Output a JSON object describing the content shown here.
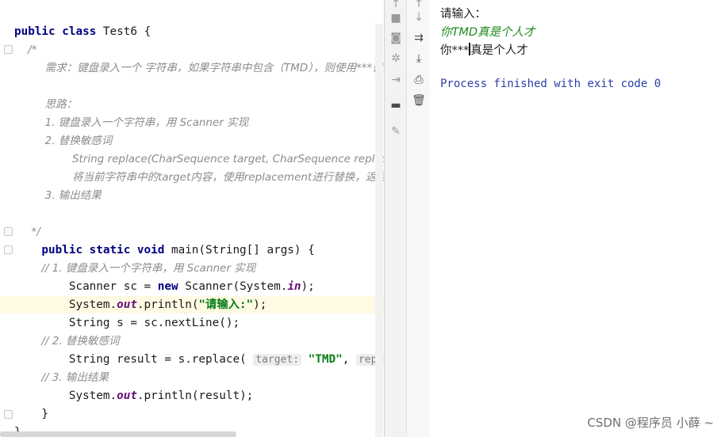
{
  "editor": {
    "lines": [
      {
        "parts": [
          {
            "t": "public ",
            "c": "kw"
          },
          {
            "t": "class ",
            "c": "kw"
          },
          {
            "t": "Test6 {",
            "c": ""
          }
        ]
      },
      {
        "parts": [
          {
            "t": "    /*",
            "c": "cm"
          }
        ]
      },
      {
        "parts": [
          {
            "t": "         需求：键盘录入一个 字符串，如果字符串中包含（TMD），则使用***替换",
            "c": "cm"
          }
        ]
      },
      {
        "parts": [
          {
            "t": "",
            "c": ""
          }
        ]
      },
      {
        "parts": [
          {
            "t": "         思路：",
            "c": "cm"
          }
        ]
      },
      {
        "parts": [
          {
            "t": "         1. 键盘录入一个字符串，用 Scanner 实现",
            "c": "cm"
          }
        ]
      },
      {
        "parts": [
          {
            "t": "         2. 替换敏感词",
            "c": "cm"
          }
        ]
      },
      {
        "parts": [
          {
            "t": "                 String replace(CharSequence target, CharSequence replacement)",
            "c": "cm"
          }
        ]
      },
      {
        "parts": [
          {
            "t": "                 将当前字符串中的target内容，使用replacement进行替换，返回新的字符串",
            "c": "cm"
          }
        ]
      },
      {
        "parts": [
          {
            "t": "         3. 输出结果",
            "c": "cm"
          }
        ]
      },
      {
        "parts": [
          {
            "t": "",
            "c": ""
          }
        ]
      },
      {
        "parts": [
          {
            "t": "",
            "c": ""
          }
        ]
      },
      {
        "parts": [
          {
            "t": "     */",
            "c": "cm"
          }
        ]
      },
      {
        "parts": [
          {
            "t": "    public static void ",
            "c": "kw"
          },
          {
            "t": "main(String[] args) {",
            "c": ""
          }
        ]
      },
      {
        "parts": [
          {
            "t": "        // 1. 键盘录入一个字符串，用 Scanner 实现",
            "c": "cm"
          }
        ]
      },
      {
        "parts": [
          {
            "t": "        Scanner sc = ",
            "c": ""
          },
          {
            "t": "new ",
            "c": "kw"
          },
          {
            "t": "Scanner(System.",
            "c": ""
          },
          {
            "t": "in",
            "c": "fld"
          },
          {
            "t": ");",
            "c": ""
          }
        ]
      },
      {
        "parts": [
          {
            "t": "        System.",
            "c": ""
          },
          {
            "t": "out",
            "c": "fld"
          },
          {
            "t": ".println(",
            "c": ""
          },
          {
            "t": "\"请输入:\"",
            "c": "str"
          },
          {
            "t": ");",
            "c": ""
          }
        ]
      },
      {
        "parts": [
          {
            "t": "        String s = sc.nextLine();",
            "c": ""
          }
        ]
      },
      {
        "parts": [
          {
            "t": "        // 2. 替换敏感词",
            "c": "cm"
          }
        ]
      },
      {
        "parts": [
          {
            "t": "        String result = s.replace( ",
            "c": ""
          },
          {
            "t": "target:",
            "c": "hint"
          },
          {
            "t": " ",
            "c": ""
          },
          {
            "t": "\"TMD\"",
            "c": "str"
          },
          {
            "t": ", ",
            "c": ""
          },
          {
            "t": "replacement:",
            "c": "hint"
          },
          {
            "t": " ",
            "c": ""
          },
          {
            "t": "\"***\"",
            "c": "str"
          },
          {
            "t": ");",
            "c": ""
          }
        ]
      },
      {
        "parts": [
          {
            "t": "        // 3. 输出结果",
            "c": "cm"
          }
        ]
      },
      {
        "parts": [
          {
            "t": "        System.",
            "c": ""
          },
          {
            "t": "out",
            "c": "fld"
          },
          {
            "t": ".println(result);",
            "c": ""
          }
        ]
      },
      {
        "parts": [
          {
            "t": "    }",
            "c": ""
          }
        ]
      },
      {
        "parts": [
          {
            "t": "}",
            "c": ""
          }
        ]
      }
    ]
  },
  "toolbar": {
    "left_icons": [
      "up-arrow-icon",
      "stop-icon",
      "camera-icon",
      "settings-icon",
      "exit-icon",
      "layout-icon",
      "pin-icon"
    ],
    "right_icons": [
      "down-arrow-icon",
      "soft-wrap-icon",
      "scroll-to-end-icon",
      "print-icon",
      "trash-icon"
    ]
  },
  "console": {
    "prompt": "请输入：",
    "input_echo": "你TMD真是个人才",
    "output_prefix": "你***",
    "output_suffix": "真是个人才",
    "process_line": "Process finished with exit code 0"
  },
  "watermark": "CSDN @程序员 小薛 ~"
}
